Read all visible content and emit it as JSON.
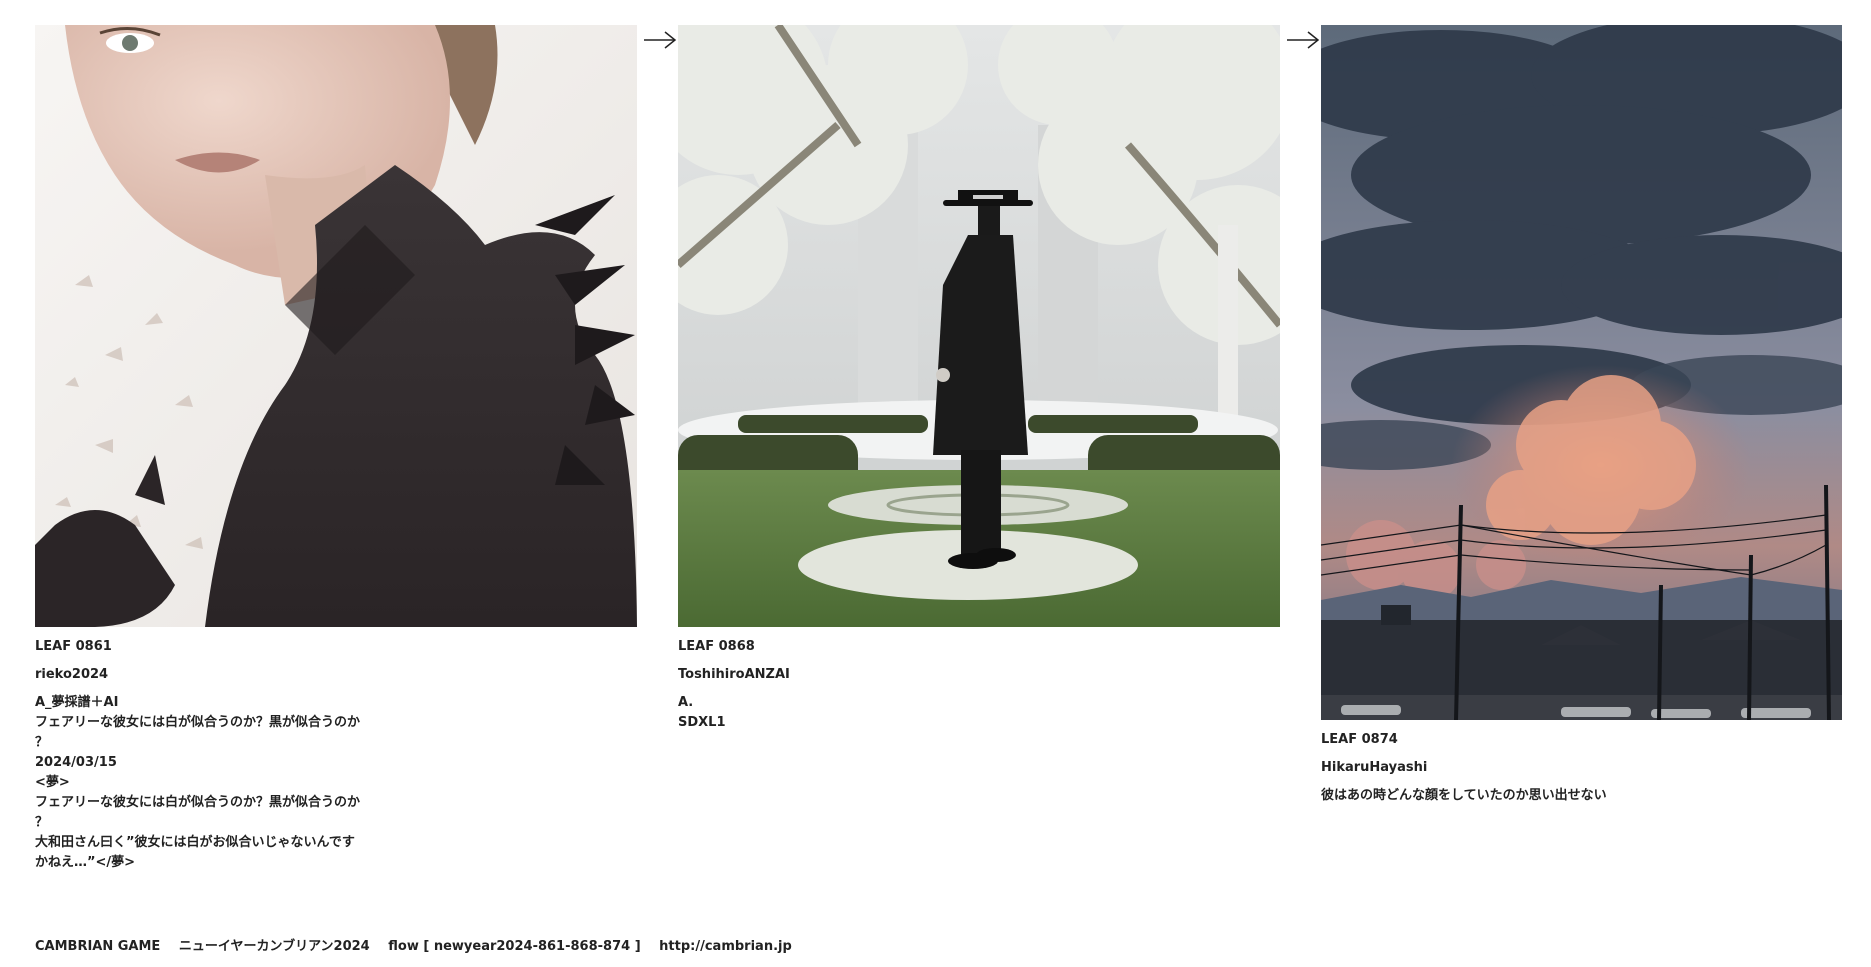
{
  "leaves": [
    {
      "id_label": "LEAF 0861",
      "author": "rieko2024",
      "description": [
        "A_夢採譜＋AI",
        "フェアリーな彼女には白が似合うのか？黒が似合うのか",
        "？",
        "2024/03/15",
        "<夢>",
        "フェアリーな彼女には白が似合うのか？黒が似合うのか",
        "？",
        "大和田さん曰く”彼女には白がお似合いじゃないんです",
        "かねえ…”</夢>"
      ]
    },
    {
      "id_label": "LEAF 0868",
      "author": "ToshihiroANZAI",
      "description": [
        "A.",
        "SDXL1"
      ]
    },
    {
      "id_label": "LEAF 0874",
      "author": "HikaruHayashi",
      "description": [
        "彼はあの時どんな顔をしていたのか思い出せない"
      ]
    }
  ],
  "footer": {
    "game": "CAMBRIAN GAME",
    "title": "ニューイヤーカンブリアン2024",
    "flow": "flow [ newyear2024-861-868-874 ]",
    "url": "http://cambrian.jp"
  },
  "arrow_icon": "right-arrow-icon"
}
